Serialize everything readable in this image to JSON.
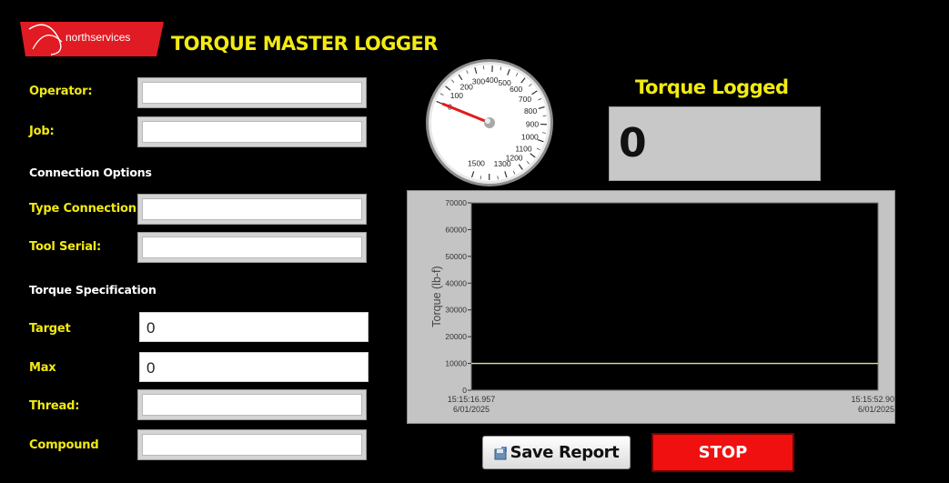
{
  "app": {
    "title": "TORQUE MASTER LOGGER",
    "brand": "northservices"
  },
  "form": {
    "operator_label": "Operator:",
    "operator_value": "",
    "job_label": "Job:",
    "job_value": "",
    "connection_section": "Connection Options",
    "type_connection_label": "Type Connection",
    "type_connection_value": "",
    "tool_serial_label": "Tool Serial:",
    "tool_serial_value": "",
    "torque_spec_section": "Torque Specification",
    "target_label": "Target",
    "target_value": "0",
    "max_label": "Max",
    "max_value": "0",
    "thread_label": "Thread:",
    "thread_value": "",
    "compound_label": "Compound",
    "compound_value": ""
  },
  "gauge": {
    "tick_labels": [
      "0",
      "100",
      "200",
      "300",
      "400",
      "500",
      "600",
      "700",
      "800",
      "900",
      "1000",
      "1100",
      "1200",
      "1300",
      "1500"
    ],
    "min": 0,
    "max": 1500,
    "value": 0
  },
  "torque_logged": {
    "label": "Torque Logged",
    "value": "0"
  },
  "chart_data": {
    "type": "line",
    "ylabel": "Torque (lb-f)",
    "ylim": [
      0,
      70000
    ],
    "yticks": [
      "0",
      "10000",
      "20000",
      "30000",
      "40000",
      "50000",
      "60000",
      "70000"
    ],
    "x_start": [
      "15:15:16.957",
      "6/01/2025"
    ],
    "x_end": [
      "15:15:52.90",
      "6/01/2025"
    ],
    "series": [
      {
        "values": [
          10000,
          10000
        ],
        "color": "#d8e87a"
      }
    ],
    "plot_bg": "#000000"
  },
  "buttons": {
    "save_report": "Save Report",
    "stop": "STOP"
  },
  "colors": {
    "accent_yellow": "#f2ea12",
    "stop_red": "#f01010"
  }
}
